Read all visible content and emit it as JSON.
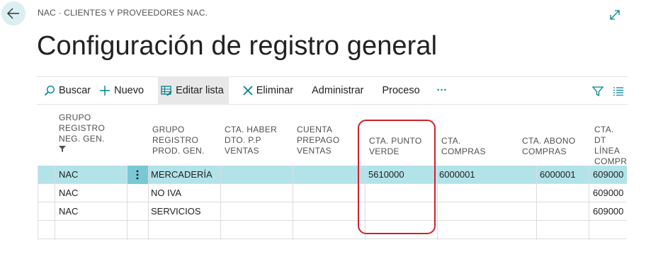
{
  "breadcrumb": "NAC · CLIENTES Y PROVEEDORES NAC.",
  "page_title": "Configuración de registro general",
  "toolbar": {
    "search": "Buscar",
    "new": "Nuevo",
    "edit_list": "Editar lista",
    "delete": "Eliminar",
    "manage": "Administrar",
    "process": "Proceso",
    "more": "···"
  },
  "columns": {
    "c1": [
      "GRUPO",
      "REGISTRO",
      "NEG. GEN."
    ],
    "c2": [
      "GRUPO",
      "REGISTRO",
      "PROD. GEN."
    ],
    "c3": [
      "CTA. HABER",
      "DTO. P.P",
      "VENTAS"
    ],
    "c4": [
      "CUENTA",
      "PREPAGO",
      "VENTAS"
    ],
    "c5": [
      "CTA. PUNTO",
      "VERDE"
    ],
    "c6": [
      "CTA.",
      "COMPRAS"
    ],
    "c7": [
      "CTA. ABONO",
      "COMPRAS"
    ],
    "c8": [
      "CTA. DT",
      "LÍNEA",
      "COMPR"
    ]
  },
  "rows": [
    {
      "neg": "NAC",
      "prod": "MERCADERÍA",
      "dto": "",
      "prepago": "",
      "punto_verde": "5610000",
      "compras": "6000001",
      "abono": "6000001",
      "linea": "609000"
    },
    {
      "neg": "NAC",
      "prod": "NO IVA",
      "dto": "",
      "prepago": "",
      "punto_verde": "",
      "compras": "",
      "abono": "",
      "linea": "609000"
    },
    {
      "neg": "NAC",
      "prod": "SERVICIOS",
      "dto": "",
      "prepago": "",
      "punto_verde": "",
      "compras": "",
      "abono": "",
      "linea": "609000"
    },
    {
      "neg": "",
      "prod": "",
      "dto": "",
      "prepago": "",
      "punto_verde": "",
      "compras": "",
      "abono": "",
      "linea": ""
    }
  ],
  "colors": {
    "accent": "#00838f",
    "selected_row": "#b2e3e9",
    "highlight": "#d01f2f"
  }
}
